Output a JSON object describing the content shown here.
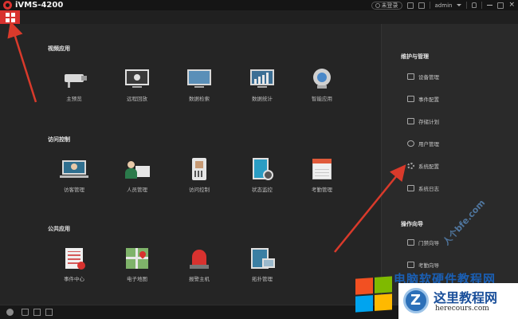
{
  "titlebar": {
    "app_title": "iVMS-4200",
    "login_status": "未登录",
    "username": "admin"
  },
  "main": {
    "sections": [
      {
        "title": "视频应用",
        "apps": [
          "主预览",
          "远程回放",
          "数据检索",
          "数据统计",
          "智能应用"
        ]
      },
      {
        "title": "访问控制",
        "apps": [
          "访客管理",
          "人员管理",
          "访问控制",
          "状态监控",
          "考勤管理"
        ]
      },
      {
        "title": "公共应用",
        "apps": [
          "事件中心",
          "电子地图",
          "报警主机",
          "拓扑管理"
        ]
      }
    ]
  },
  "right_panel": {
    "maintenance_title": "维护与管理",
    "maintenance_items": [
      "设备管理",
      "事件配置",
      "存储计划",
      "用户管理",
      "系统配置",
      "系统日志"
    ],
    "guide_title": "操作向导",
    "guide_items": [
      "门禁向导",
      "考勤向导"
    ]
  },
  "watermarks": {
    "diagonal": "人个bfe.com",
    "blue_line": "电脑软硬件教程网",
    "brand_title": "这里教程网",
    "brand_url": "herecours.com"
  },
  "colors": {
    "accent": "#d8322f",
    "arrow": "#d93a2b",
    "background": "#252525",
    "panel": "#2a2a2a",
    "watermark_blue": "#1a5fb4"
  },
  "icons": {
    "menu": "grid-icon",
    "maintenance": [
      "device-icon",
      "event-icon",
      "storage-icon",
      "user-icon",
      "gear-icon",
      "log-icon"
    ],
    "guide": [
      "door-icon",
      "attendance-icon"
    ]
  }
}
